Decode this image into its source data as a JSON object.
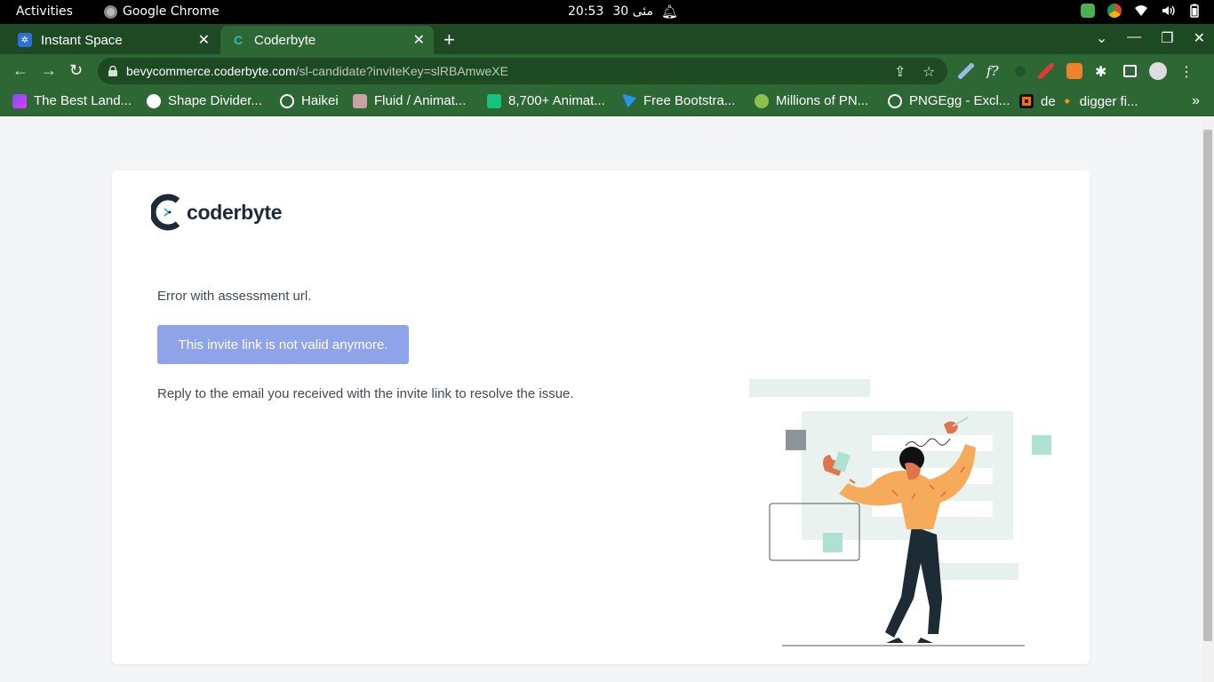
{
  "system_bar": {
    "activities": "Activities",
    "app_name": "Google Chrome",
    "time": "20:53",
    "date": "30 مئى"
  },
  "tabs": [
    {
      "title": "Instant Space",
      "active": false
    },
    {
      "title": "Coderbyte",
      "active": true
    }
  ],
  "omnibox": {
    "host": "bevycommerce.coderbyte.com",
    "path": "/sl-candidate?inviteKey=slRBAmweXE"
  },
  "bookmarks": [
    {
      "label": "The Best Land...",
      "icon": "purple-icon"
    },
    {
      "label": "Shape Divider...",
      "icon": "shape-icon"
    },
    {
      "label": "Haikei",
      "icon": "globe-icon"
    },
    {
      "label": "Fluid / Animat...",
      "icon": "fluid-icon"
    },
    {
      "label": "8,700+ Animat...",
      "icon": "crown-icon"
    },
    {
      "label": "Free Bootstra...",
      "icon": "bootstrap-icon"
    },
    {
      "label": "Millions of PN...",
      "icon": "pngwing-icon"
    },
    {
      "label": "PNGEgg - Excl...",
      "icon": "globe-icon"
    },
    {
      "label": "de 🔸 digger fi...",
      "icon": "digger-icon"
    }
  ],
  "page": {
    "logo_text": "coderbyte",
    "error_message": "Error with assessment url.",
    "invalid_notice": "This invite link is not valid anymore.",
    "reply_instruction": "Reply to the email you received with the invite link to resolve the issue."
  },
  "colors": {
    "chrome_frame": "#1d4a23",
    "chrome_toolbar": "#2d6834",
    "notice_button": "#8ea3e8",
    "logo_dark": "#1e2a3a"
  }
}
